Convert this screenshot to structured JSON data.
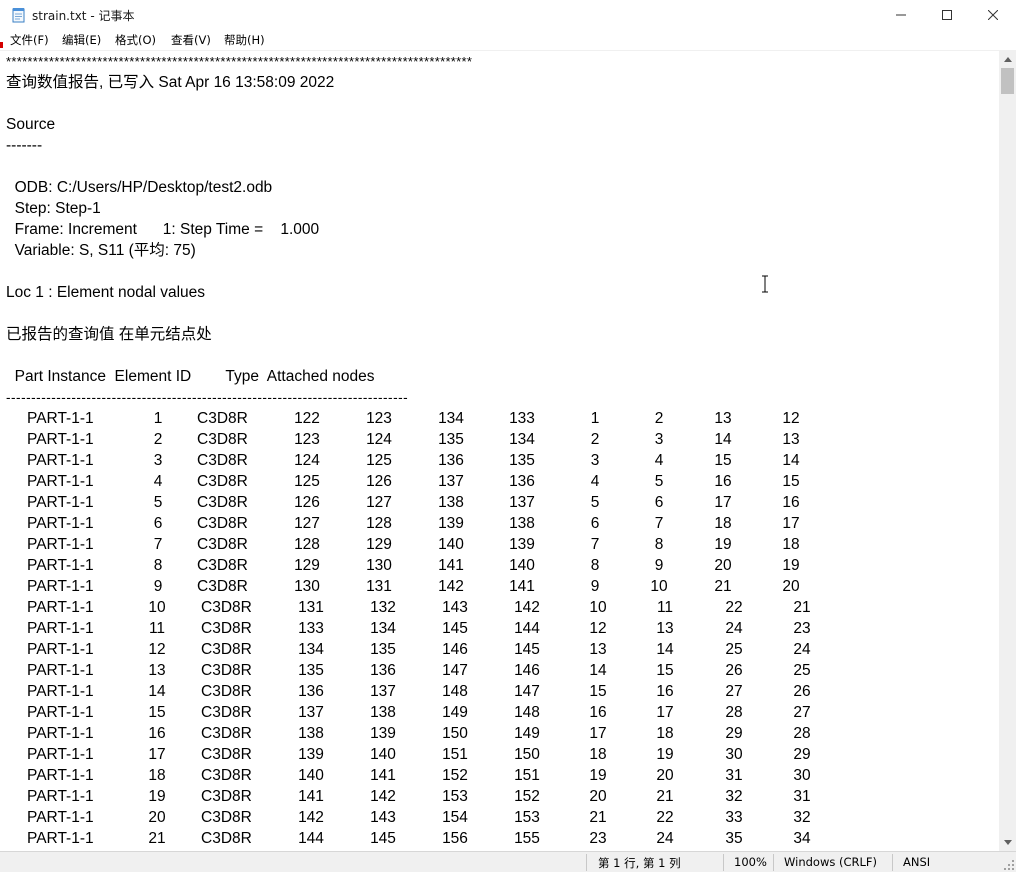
{
  "window": {
    "title": "strain.txt - 记事本",
    "icon": "notepad-icon"
  },
  "menu": [
    "文件(F)",
    "编辑(E)",
    "格式(O)",
    "查看(V)",
    "帮助(H)"
  ],
  "document": {
    "stars": "***************************************************************************************",
    "report_line": "查询数值报告, 已写入 Sat Apr 16 13:58:09 2022",
    "source_heading": "Source",
    "source_underline": "-------",
    "odb_line": "  ODB: C:/Users/HP/Desktop/test2.odb",
    "step_line": "  Step: Step-1",
    "frame_line": "  Frame: Increment      1: Step Time =    1.000",
    "variable_line": "  Variable: S, S11 (平均: 75)",
    "loc_line": "Loc 1 : Element nodal values",
    "reported_line": "已报告的查询值 在单元结点处",
    "header_line": "  Part Instance  Element ID        Type  Attached nodes",
    "separator_line": "--------------------------------------------------------------------------------",
    "rows": [
      [
        "PART-1-1",
        "1",
        "C3D8R",
        "122",
        "123",
        "134",
        "133",
        "1",
        "2",
        "13",
        "12"
      ],
      [
        "PART-1-1",
        "2",
        "C3D8R",
        "123",
        "124",
        "135",
        "134",
        "2",
        "3",
        "14",
        "13"
      ],
      [
        "PART-1-1",
        "3",
        "C3D8R",
        "124",
        "125",
        "136",
        "135",
        "3",
        "4",
        "15",
        "14"
      ],
      [
        "PART-1-1",
        "4",
        "C3D8R",
        "125",
        "126",
        "137",
        "136",
        "4",
        "5",
        "16",
        "15"
      ],
      [
        "PART-1-1",
        "5",
        "C3D8R",
        "126",
        "127",
        "138",
        "137",
        "5",
        "6",
        "17",
        "16"
      ],
      [
        "PART-1-1",
        "6",
        "C3D8R",
        "127",
        "128",
        "139",
        "138",
        "6",
        "7",
        "18",
        "17"
      ],
      [
        "PART-1-1",
        "7",
        "C3D8R",
        "128",
        "129",
        "140",
        "139",
        "7",
        "8",
        "19",
        "18"
      ],
      [
        "PART-1-1",
        "8",
        "C3D8R",
        "129",
        "130",
        "141",
        "140",
        "8",
        "9",
        "20",
        "19"
      ],
      [
        "PART-1-1",
        "9",
        "C3D8R",
        "130",
        "131",
        "142",
        "141",
        "9",
        "10",
        "21",
        "20"
      ],
      [
        "PART-1-1",
        "10",
        "C3D8R",
        "131",
        "132",
        "143",
        "142",
        "10",
        "11",
        "22",
        "21"
      ],
      [
        "PART-1-1",
        "11",
        "C3D8R",
        "133",
        "134",
        "145",
        "144",
        "12",
        "13",
        "24",
        "23"
      ],
      [
        "PART-1-1",
        "12",
        "C3D8R",
        "134",
        "135",
        "146",
        "145",
        "13",
        "14",
        "25",
        "24"
      ],
      [
        "PART-1-1",
        "13",
        "C3D8R",
        "135",
        "136",
        "147",
        "146",
        "14",
        "15",
        "26",
        "25"
      ],
      [
        "PART-1-1",
        "14",
        "C3D8R",
        "136",
        "137",
        "148",
        "147",
        "15",
        "16",
        "27",
        "26"
      ],
      [
        "PART-1-1",
        "15",
        "C3D8R",
        "137",
        "138",
        "149",
        "148",
        "16",
        "17",
        "28",
        "27"
      ],
      [
        "PART-1-1",
        "16",
        "C3D8R",
        "138",
        "139",
        "150",
        "149",
        "17",
        "18",
        "29",
        "28"
      ],
      [
        "PART-1-1",
        "17",
        "C3D8R",
        "139",
        "140",
        "151",
        "150",
        "18",
        "19",
        "30",
        "29"
      ],
      [
        "PART-1-1",
        "18",
        "C3D8R",
        "140",
        "141",
        "152",
        "151",
        "19",
        "20",
        "31",
        "30"
      ],
      [
        "PART-1-1",
        "19",
        "C3D8R",
        "141",
        "142",
        "153",
        "152",
        "20",
        "21",
        "32",
        "31"
      ],
      [
        "PART-1-1",
        "20",
        "C3D8R",
        "142",
        "143",
        "154",
        "153",
        "21",
        "22",
        "33",
        "32"
      ],
      [
        "PART-1-1",
        "21",
        "C3D8R",
        "144",
        "145",
        "156",
        "155",
        "23",
        "24",
        "35",
        "34"
      ]
    ]
  },
  "status": {
    "position": "第 1 行, 第 1 列",
    "zoom": "100%",
    "line_ending": "Windows (CRLF)",
    "encoding": "ANSI"
  }
}
